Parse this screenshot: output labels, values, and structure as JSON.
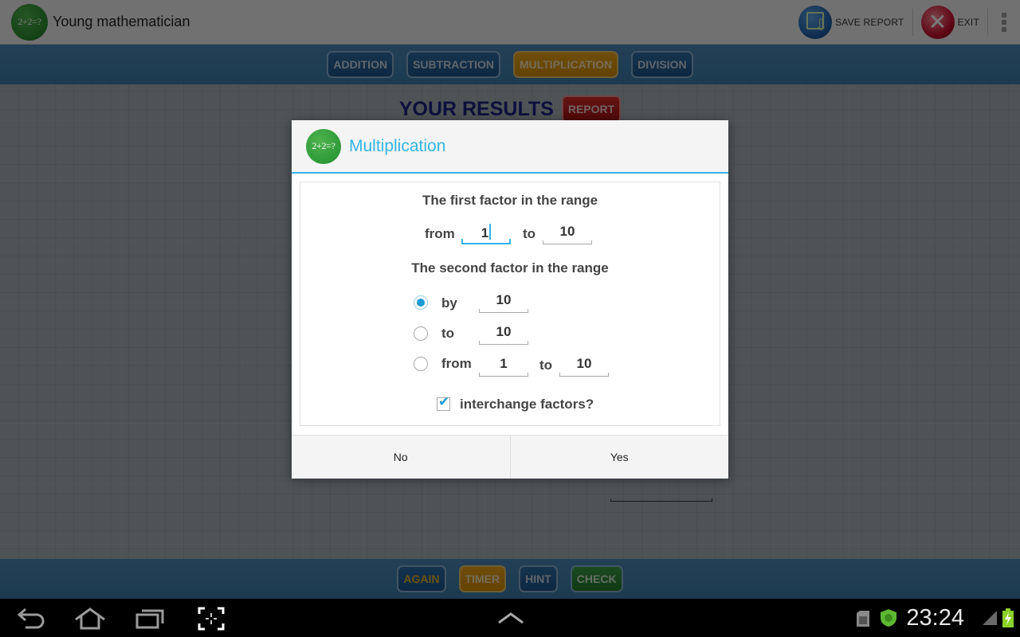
{
  "app": {
    "title": "Young mathematician",
    "logo_text": "2+2=?",
    "actions": {
      "save_report": "SAVE REPORT",
      "exit": "EXIT"
    }
  },
  "tabs": [
    {
      "label": "ADDITION",
      "active": false
    },
    {
      "label": "SUBTRACTION",
      "active": false
    },
    {
      "label": "MULTIPLICATION",
      "active": true
    },
    {
      "label": "DIVISION",
      "active": false
    }
  ],
  "results": {
    "title": "YOUR RESULTS",
    "report_label": "REPORT"
  },
  "bottom_buttons": {
    "again": "AGAIN",
    "timer": "TIMER",
    "hint": "HINT",
    "check": "CHECK"
  },
  "dialog": {
    "logo_text": "2+2=?",
    "title": "Multiplication",
    "first_factor": {
      "heading": "The first factor in the range",
      "from_label": "from",
      "from_value": "1",
      "to_label": "to",
      "to_value": "10"
    },
    "second_factor": {
      "heading": "The second factor in the range",
      "options": [
        {
          "label": "by",
          "value": "10",
          "selected": true
        },
        {
          "label": "to",
          "value": "10",
          "selected": false
        },
        {
          "label": "from",
          "value": "1",
          "to_label": "to",
          "to_value": "10",
          "selected": false
        }
      ]
    },
    "interchange": {
      "label": "interchange factors?",
      "checked": true
    },
    "buttons": {
      "no": "No",
      "yes": "Yes"
    }
  },
  "system": {
    "time": "23:24",
    "accent": "#33b5e5"
  }
}
